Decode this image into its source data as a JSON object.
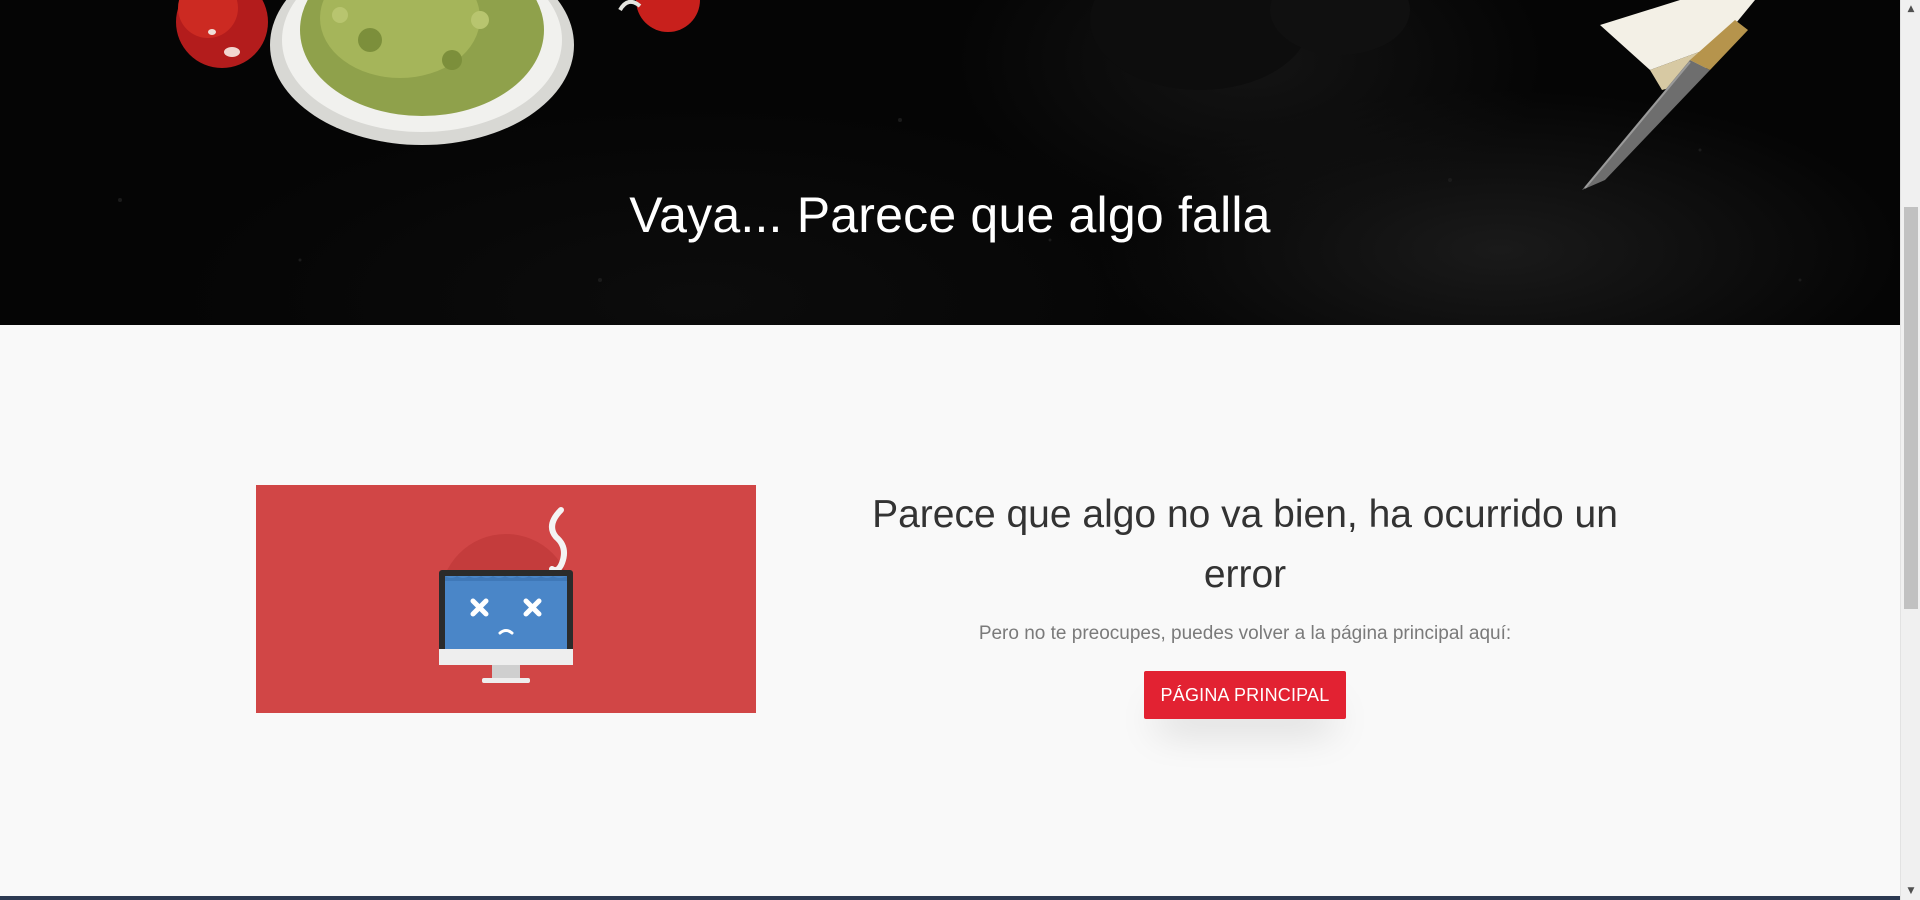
{
  "hero": {
    "title": "Vaya... Parece que algo falla"
  },
  "error": {
    "heading": "Parece que algo no va bien, ha ocurrido un error",
    "subtext": "Pero no te preocupes, puedes volver a la página principal aquí:",
    "button_label": "PÁGINA PRINCIPAL"
  },
  "icons": {
    "illustration": "broken-computer-icon",
    "scroll_up": "scroll-up-arrow-icon",
    "scroll_down": "scroll-down-arrow-icon"
  },
  "colors": {
    "hero_background": "#050505",
    "page_background": "#f9f9f9",
    "illustration_background": "#d14646",
    "button_background": "#e22232",
    "button_text": "#ffffff",
    "heading_text": "#333333",
    "subtext": "#7a7a7a",
    "screen_blue": "#4a86c8"
  }
}
